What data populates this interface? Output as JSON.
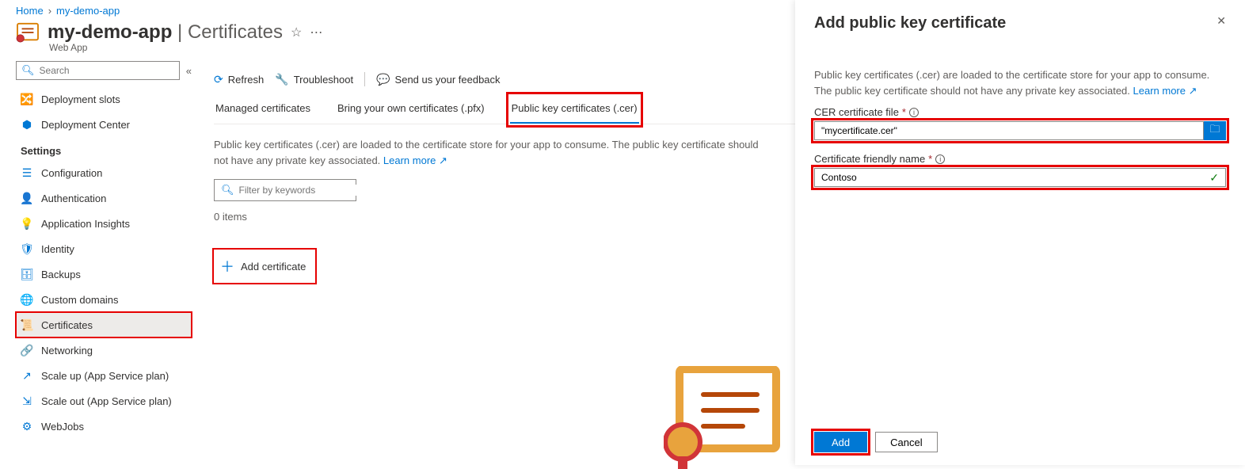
{
  "breadcrumb": {
    "home": "Home",
    "app": "my-demo-app"
  },
  "title": {
    "app": "my-demo-app",
    "sep": " | ",
    "section": "Certificates",
    "subtitle": "Web App"
  },
  "sidebar": {
    "search_placeholder": "Search",
    "items_top": [
      {
        "label": "Deployment slots"
      },
      {
        "label": "Deployment Center"
      }
    ],
    "settings_heading": "Settings",
    "items_settings": [
      {
        "label": "Configuration"
      },
      {
        "label": "Authentication"
      },
      {
        "label": "Application Insights"
      },
      {
        "label": "Identity"
      },
      {
        "label": "Backups"
      },
      {
        "label": "Custom domains"
      },
      {
        "label": "Certificates"
      },
      {
        "label": "Networking"
      },
      {
        "label": "Scale up (App Service plan)"
      },
      {
        "label": "Scale out (App Service plan)"
      },
      {
        "label": "WebJobs"
      }
    ]
  },
  "toolbar": {
    "refresh": "Refresh",
    "troubleshoot": "Troubleshoot",
    "feedback": "Send us your feedback"
  },
  "tabs": [
    {
      "label": "Managed certificates"
    },
    {
      "label": "Bring your own certificates (.pfx)"
    },
    {
      "label": "Public key certificates (.cer)"
    }
  ],
  "main": {
    "description": "Public key certificates (.cer) are loaded to the certificate store for your app to consume. The public key certificate should not have any private key associated. ",
    "learn_more": "Learn more",
    "filter_placeholder": "Filter by keywords",
    "items_count": "0 items",
    "add_certificate": "Add certificate"
  },
  "panel": {
    "title": "Add public key certificate",
    "description": "Public key certificates (.cer) are loaded to the certificate store for your app to consume. The public key certificate should not have any private key associated. ",
    "learn_more": "Learn more",
    "file_label": "CER certificate file",
    "file_value": "\"mycertificate.cer\"",
    "name_label": "Certificate friendly name",
    "name_value": "Contoso",
    "add": "Add",
    "cancel": "Cancel"
  }
}
